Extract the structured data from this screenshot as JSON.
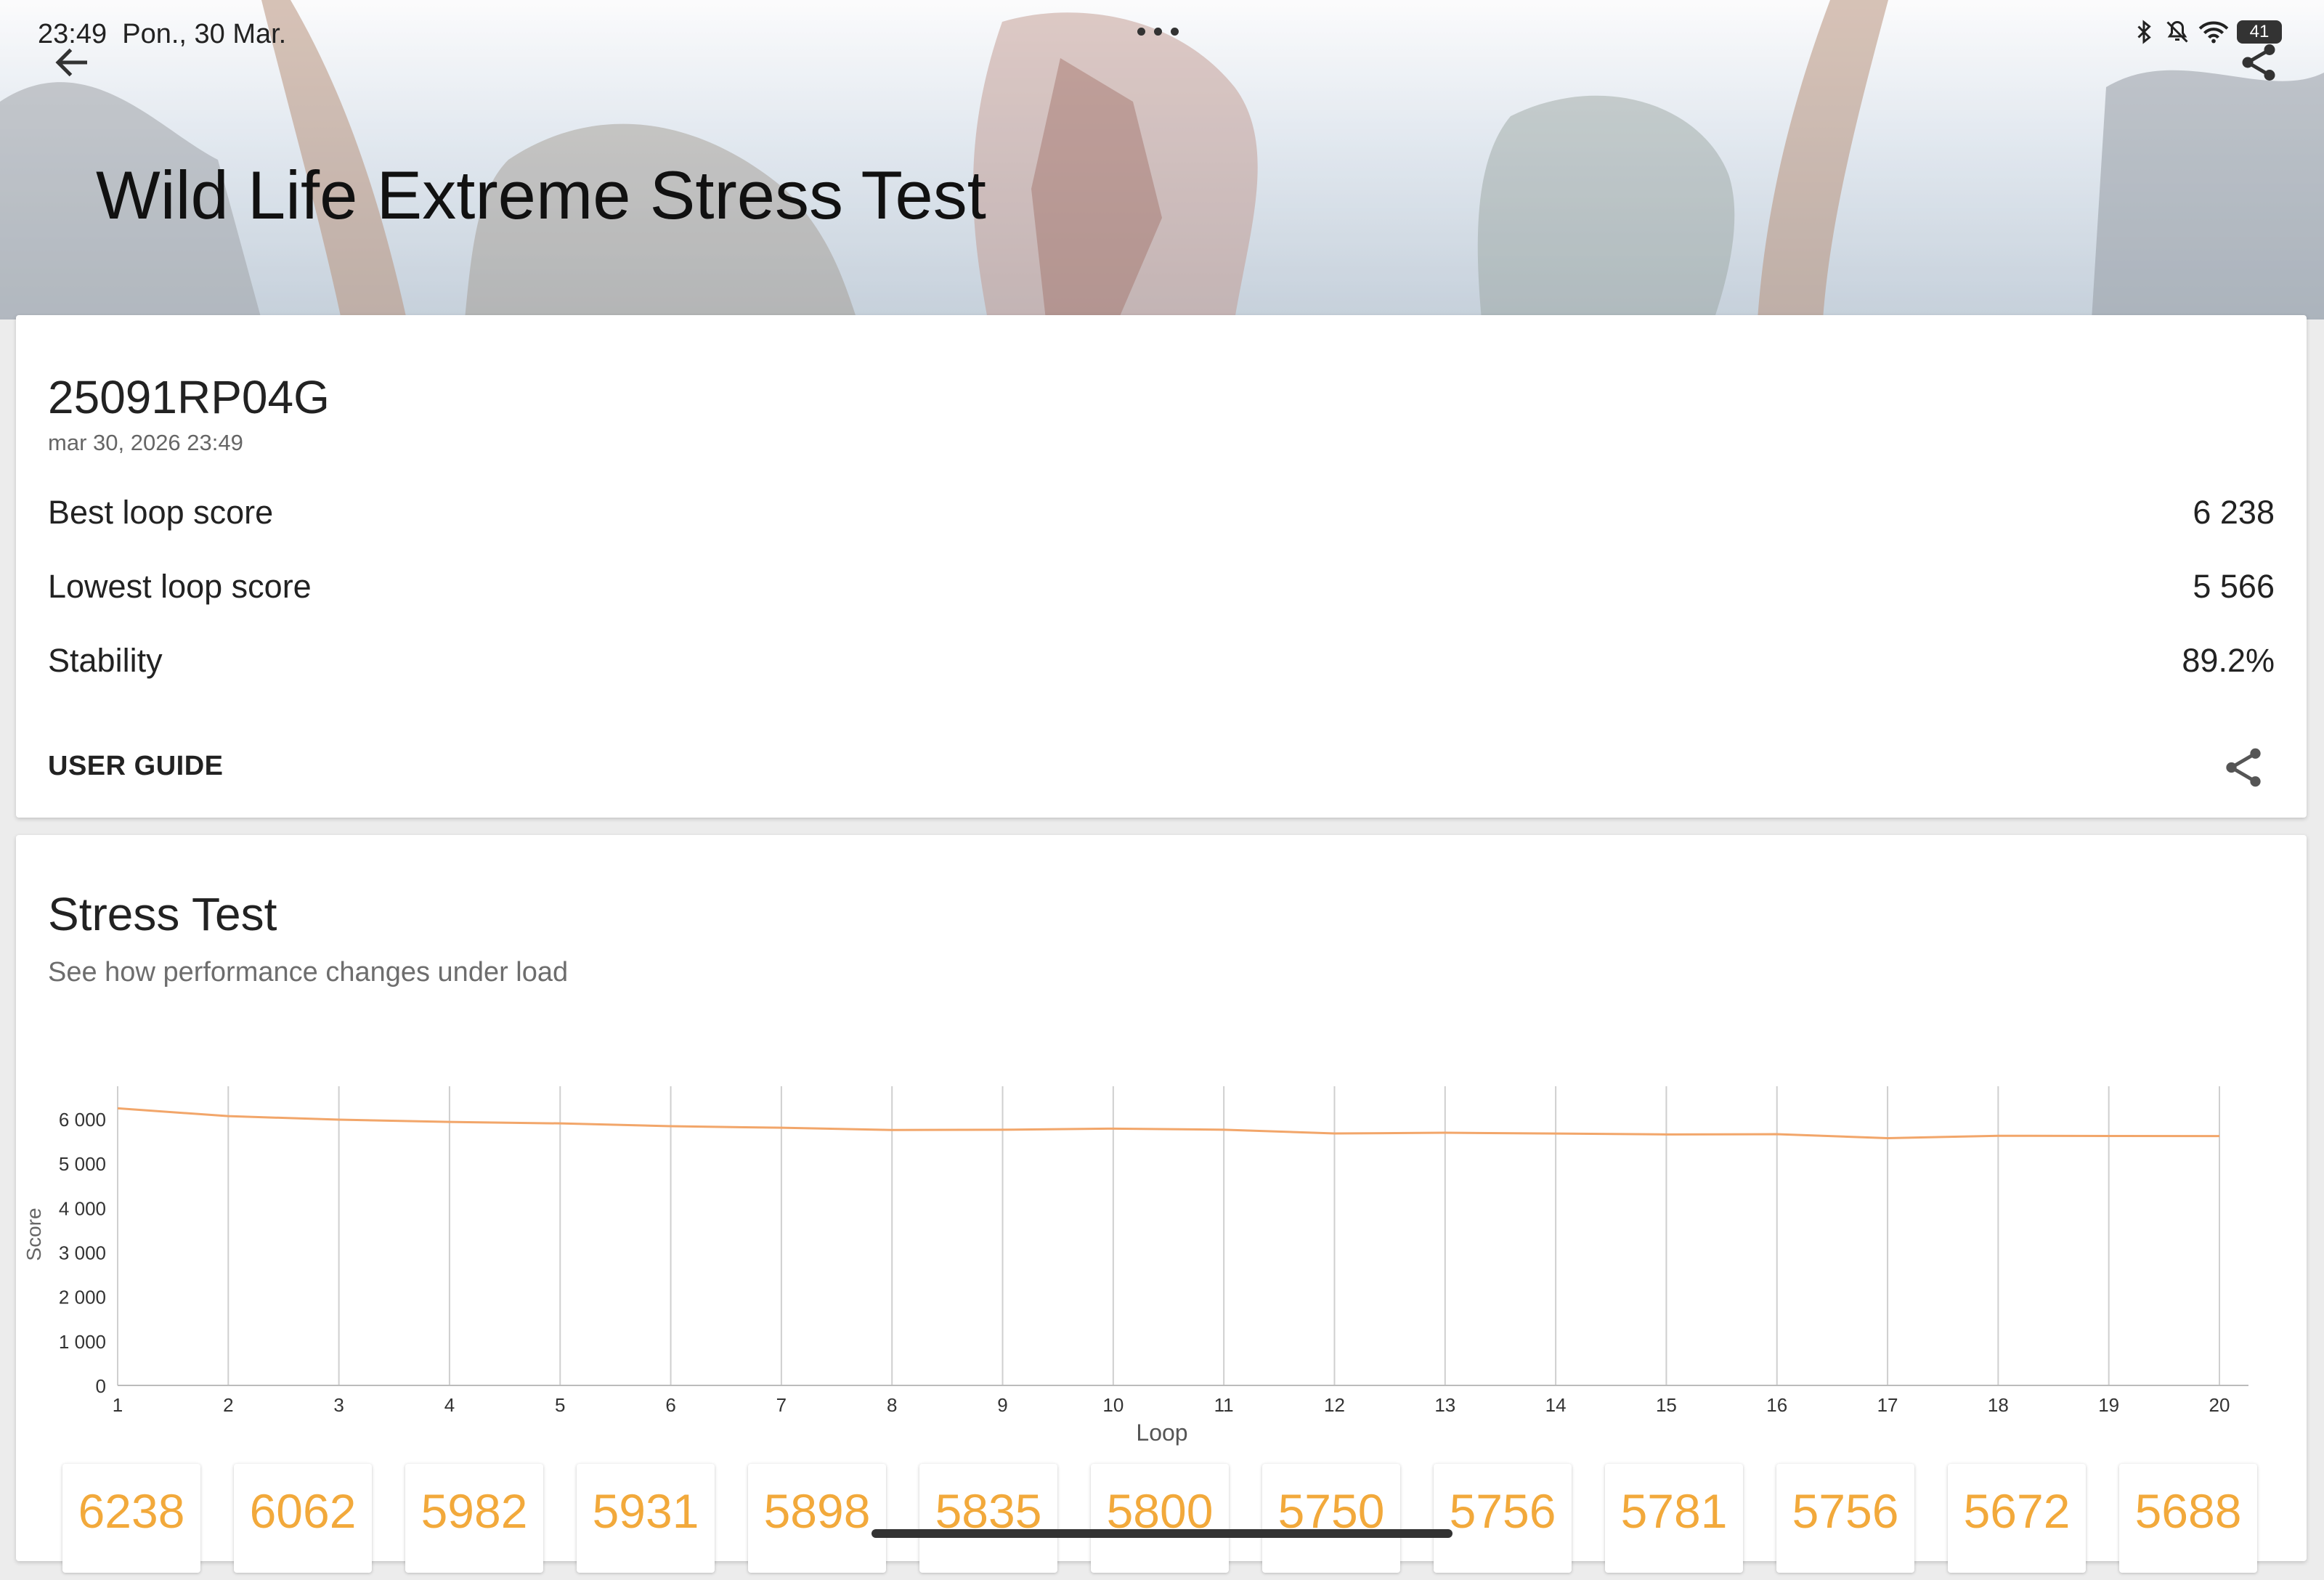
{
  "status_bar": {
    "time": "23:49",
    "date": "Pon., 30 Mar.",
    "battery": "41",
    "icons": [
      "bluetooth-icon",
      "mute-icon",
      "wifi-icon",
      "battery-icon"
    ]
  },
  "header": {
    "title": "Wild Life Extreme Stress Test"
  },
  "result": {
    "device": "25091RP04G",
    "datetime": "mar 30, 2026 23:49",
    "rows": [
      {
        "label": "Best loop score",
        "value": "6 238"
      },
      {
        "label": "Lowest loop score",
        "value": "5 566"
      },
      {
        "label": "Stability",
        "value": "89.2%"
      }
    ],
    "user_guide": "USER GUIDE"
  },
  "stress": {
    "title": "Stress Test",
    "subtitle": "See how performance changes under load"
  },
  "chart_data": {
    "type": "line",
    "xlabel": "Loop",
    "ylabel": "Score",
    "ylim": [
      0,
      6800
    ],
    "y_ticks": [
      "0",
      "1 000",
      "2 000",
      "3 000",
      "4 000",
      "5 000",
      "6 000"
    ],
    "x": [
      1,
      2,
      3,
      4,
      5,
      6,
      7,
      8,
      9,
      10,
      11,
      12,
      13,
      14,
      15,
      16,
      17,
      18,
      19,
      20
    ],
    "values": [
      6238,
      6062,
      5982,
      5931,
      5898,
      5835,
      5800,
      5750,
      5756,
      5781,
      5756,
      5672,
      5688,
      5670,
      5650,
      5655,
      5566,
      5620,
      5615,
      5612
    ],
    "grid": "vertical",
    "color": "#f2a66a"
  },
  "loop_tiles": [
    "6238",
    "6062",
    "5982",
    "5931",
    "5898",
    "5835",
    "5800",
    "5750",
    "5756",
    "5781",
    "5756",
    "5672",
    "5688"
  ]
}
